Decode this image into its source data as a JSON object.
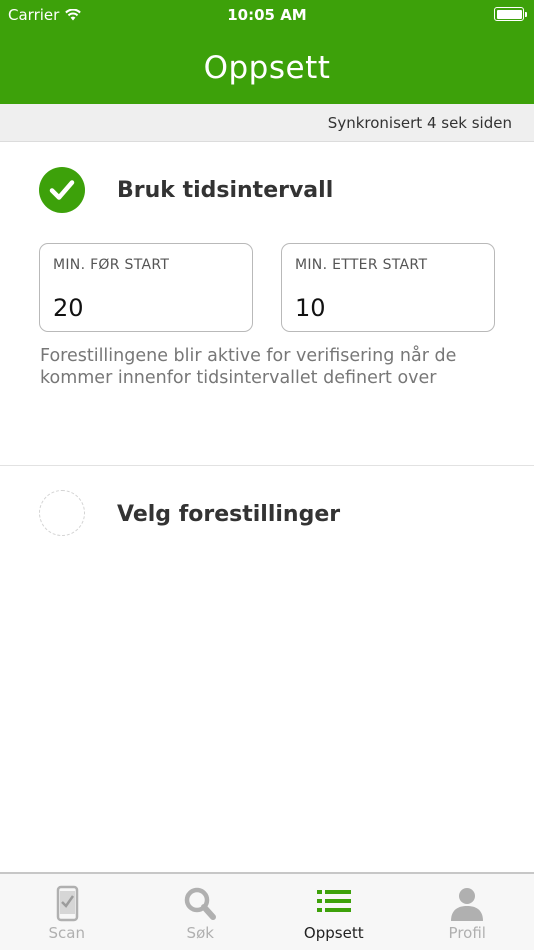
{
  "status_bar": {
    "carrier": "Carrier",
    "time": "10:05 AM"
  },
  "nav": {
    "title": "Oppsett"
  },
  "sync": {
    "text": "Synkronisert 4 sek siden"
  },
  "options": {
    "interval": {
      "label": "Bruk tidsintervall",
      "checked": true
    },
    "select": {
      "label": "Velg forestillinger",
      "checked": false
    }
  },
  "fields": {
    "before": {
      "label": "MIN. FØR START",
      "value": "20"
    },
    "after": {
      "label": "MIN. ETTER START",
      "value": "10"
    }
  },
  "hint": "Forestillingene blir aktive for verifisering når de kommer innenfor tidsintervallet definert over",
  "tabs": [
    {
      "label": "Scan",
      "icon": "phone-check-icon"
    },
    {
      "label": "Søk",
      "icon": "search-icon"
    },
    {
      "label": "Oppsett",
      "icon": "list-icon",
      "active": true
    },
    {
      "label": "Profil",
      "icon": "person-icon"
    }
  ],
  "colors": {
    "brand": "#3da10a",
    "inactive_tab": "#b0b0b0"
  }
}
